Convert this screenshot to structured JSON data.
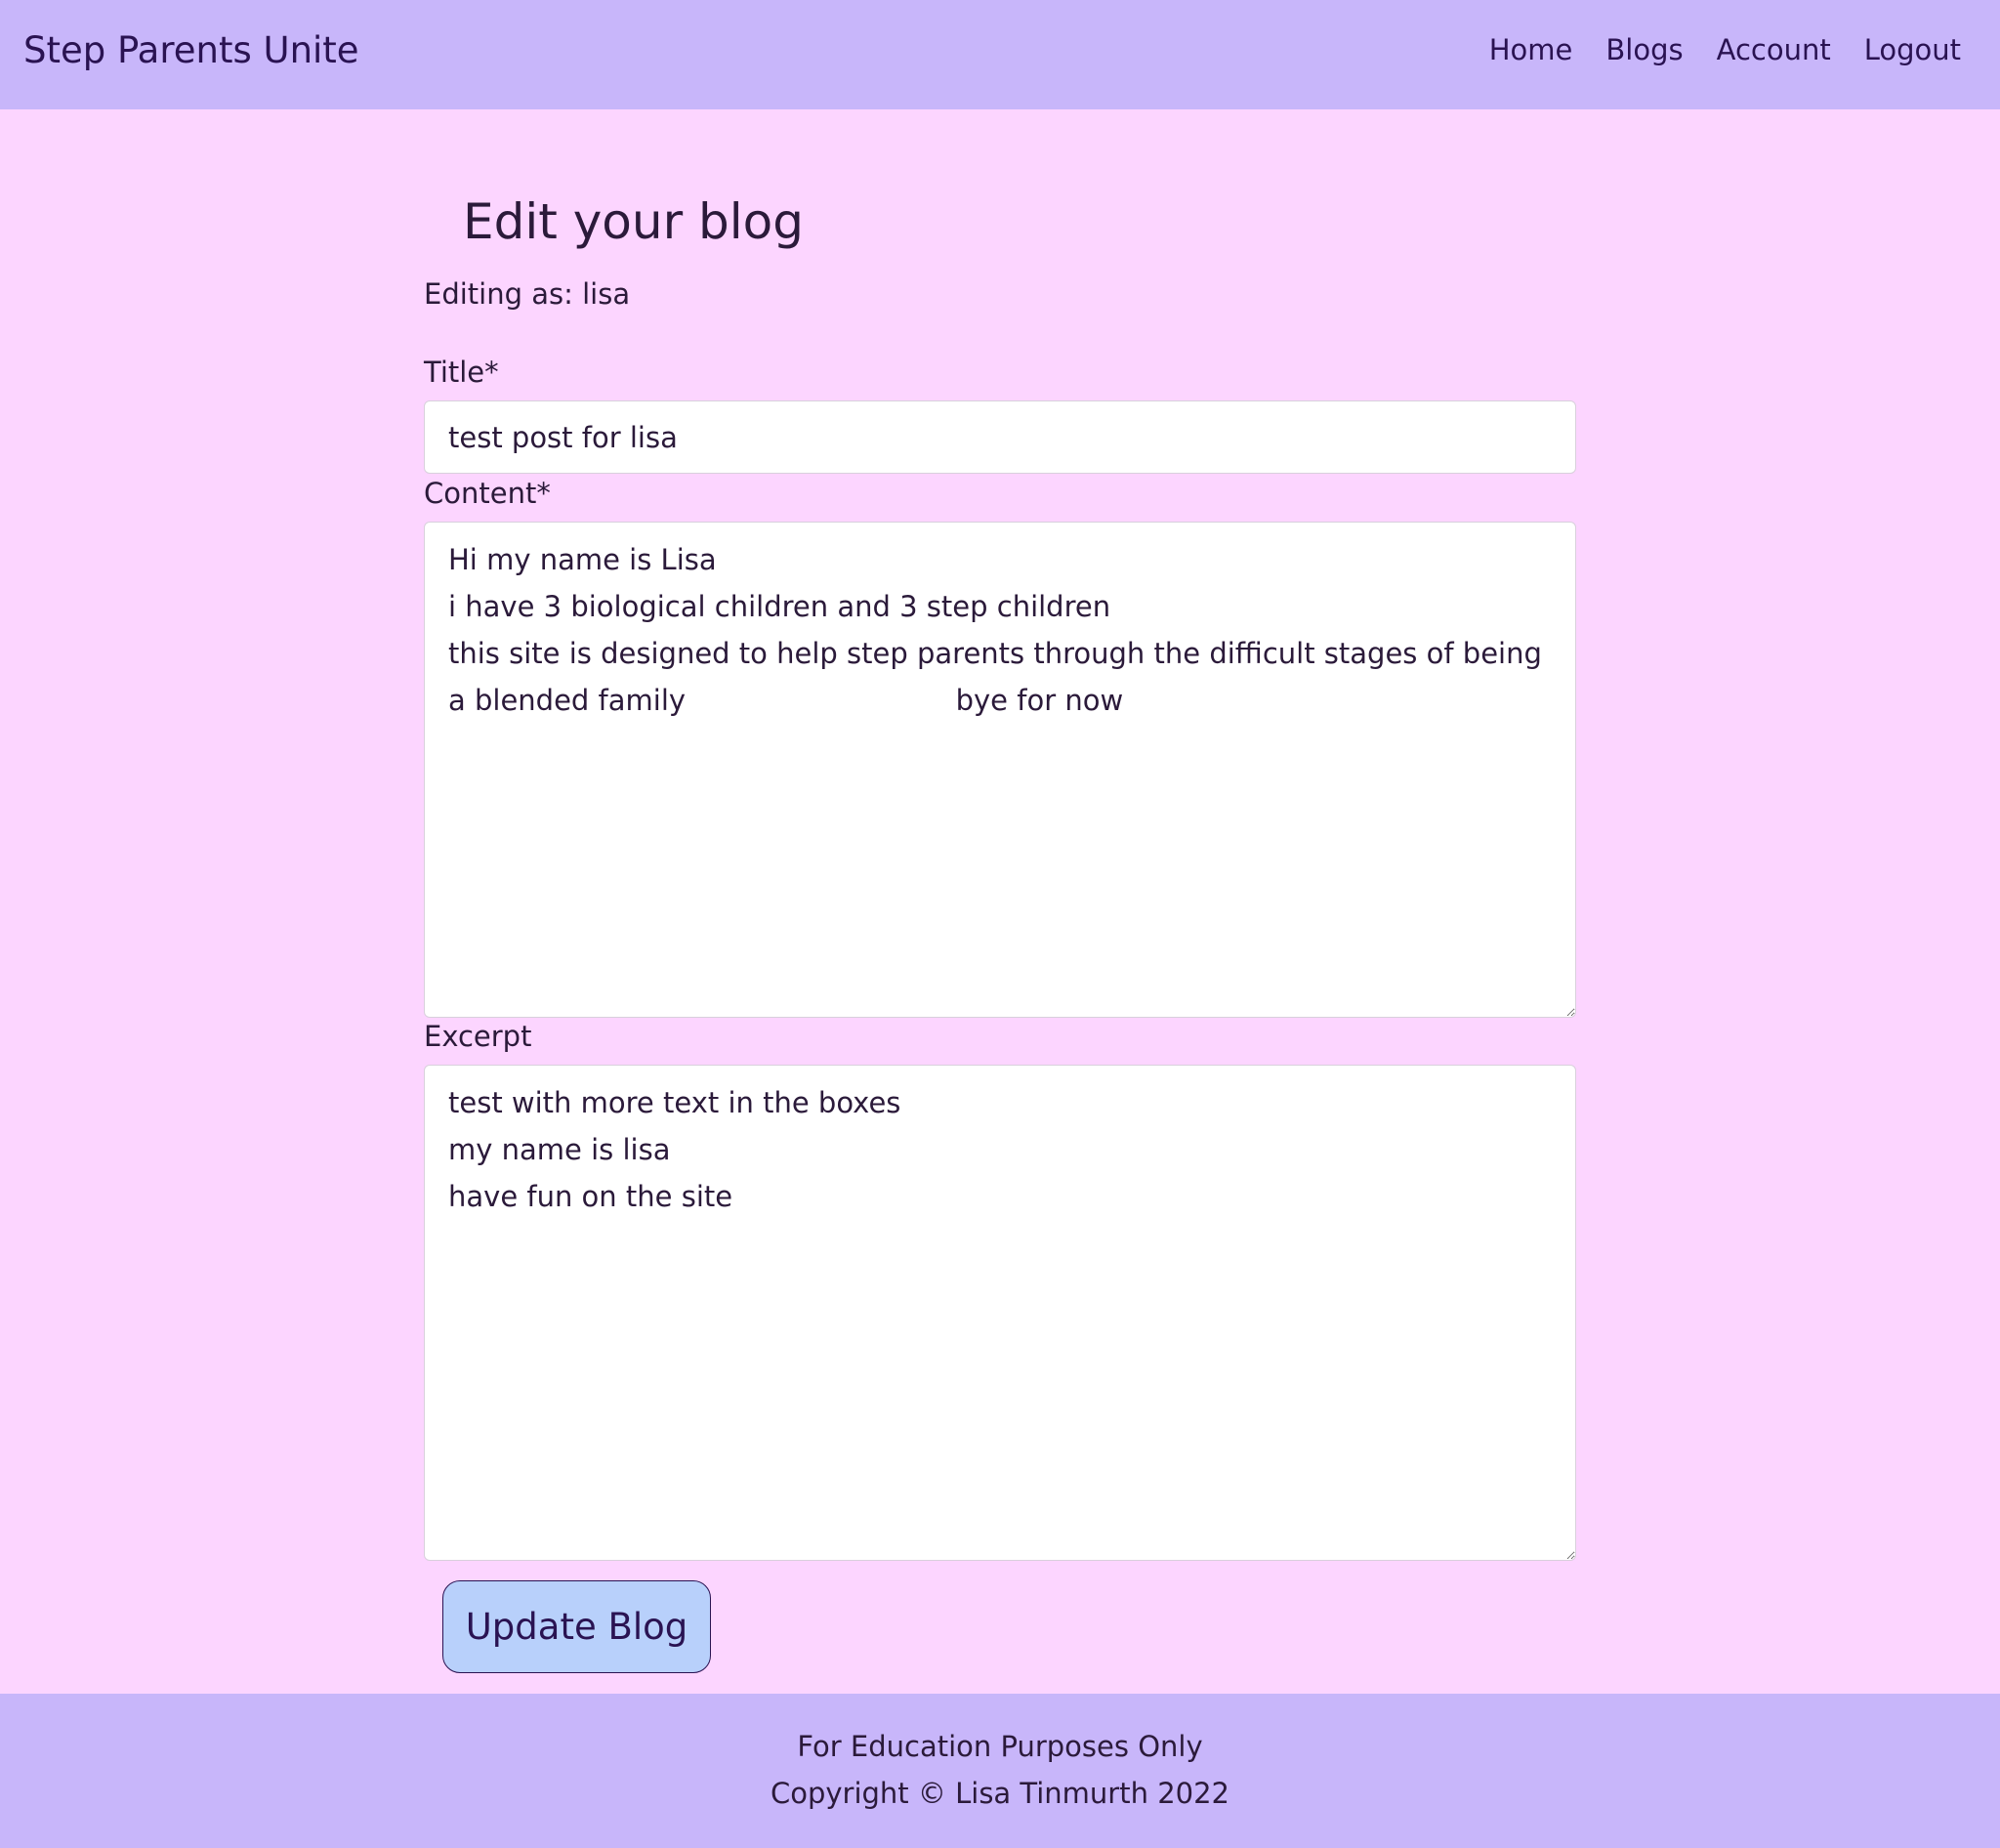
{
  "navbar": {
    "brand": "Step Parents Unite",
    "links": [
      "Home",
      "Blogs",
      "Account",
      "Logout"
    ]
  },
  "main": {
    "heading": "Edit your blog",
    "editing_as": "Editing as: lisa",
    "form": {
      "title_label": "Title*",
      "title_value": "test post for lisa",
      "content_label": "Content*",
      "content_value": "Hi my name is Lisa\ni have 3 biological children and 3 step children\nthis site is designed to help step parents through the difficult stages of being a blended family                              bye for now",
      "excerpt_label": "Excerpt",
      "excerpt_value": "test with more text in the boxes\nmy name is lisa\nhave fun on the site",
      "submit_label": "Update Blog"
    }
  },
  "footer": {
    "line1": "For Education Purposes Only",
    "line2": "Copyright © Lisa Tinmurth 2022"
  },
  "colors": {
    "page_background": "#fcd5ff",
    "navbar_background": "#c8b6fa",
    "button_background": "#b8d0fb",
    "text_dark": "#2a1352"
  }
}
